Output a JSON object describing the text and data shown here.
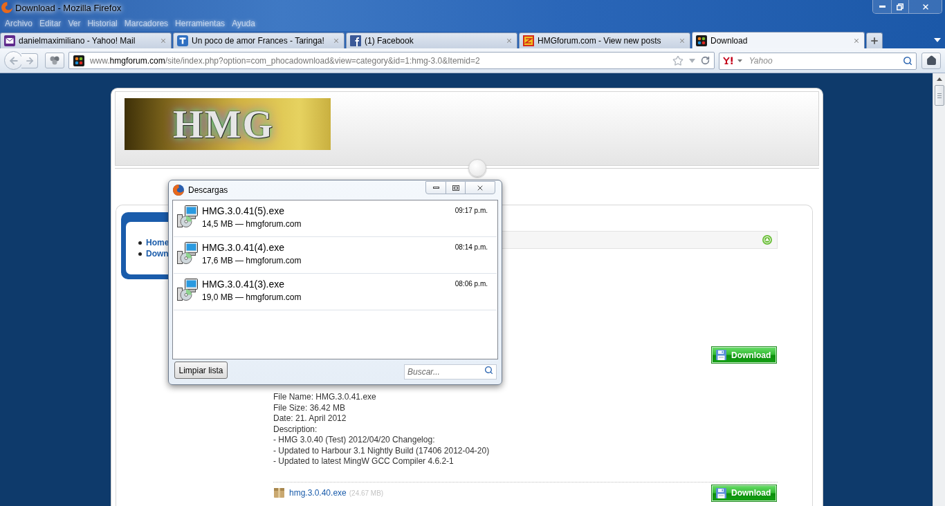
{
  "window": {
    "title": "Download - Mozilla Firefox"
  },
  "menu_bar": [
    {
      "label": "Archivo"
    },
    {
      "label": "Editar"
    },
    {
      "label": "Ver"
    },
    {
      "label": "Historial"
    },
    {
      "label": "Marcadores"
    },
    {
      "label": "Herramientas"
    },
    {
      "label": "Ayuda"
    }
  ],
  "tabs": [
    {
      "label": "danielmaximiliano - Yahoo! Mail",
      "kind": "envelope",
      "selected": false
    },
    {
      "label": "Un poco de amor Frances - Taringa!",
      "kind": "letter",
      "selected": false
    },
    {
      "label": "(1) Facebook",
      "kind": "f",
      "selected": false
    },
    {
      "label": "HMGforum.com - View new posts",
      "kind": "pattern",
      "selected": false
    },
    {
      "label": "Download",
      "kind": "dots",
      "selected": true
    }
  ],
  "address_bar": {
    "prefix": "www.",
    "domain": "hmgforum.com",
    "path": "/site/index.php?option=com_phocadownload&view=category&id=1:hmg-3.0&Itemid=2"
  },
  "search_bar": {
    "placeholder": "Yahoo"
  },
  "page": {
    "logo": {
      "text": "HMG"
    },
    "side_menu": [
      {
        "label": "Home"
      },
      {
        "label": "Down"
      }
    ],
    "download_button": "Download",
    "file_details": [
      "File Name: HMG.3.0.41.exe",
      "File Size: 36.42 MB",
      "Date: 21. April 2012",
      "Description:",
      "- HMG 3.0.40 (Test) 2012/04/20 Changelog:",
      "- Updated to Harbour 3.1 Nightly Build (17406 2012-04-20)",
      "- Updated to latest MingW GCC Compiler 4.6.2-1"
    ],
    "next_file": {
      "name": "hmg.3.0.40.exe",
      "size": "(24.67 MB)",
      "download_button": "Download"
    }
  },
  "downloads_dialog": {
    "title": "Descargas",
    "items": [
      {
        "name": "HMG.3.0.41(5).exe",
        "info": "14,5 MB — hmgforum.com",
        "time": "09:17 p.m."
      },
      {
        "name": "HMG.3.0.41(4).exe",
        "info": "17,6 MB — hmgforum.com",
        "time": "08:14 p.m."
      },
      {
        "name": "HMG.3.0.41(3).exe",
        "info": "19,0 MB — hmgforum.com",
        "time": "08:06 p.m."
      }
    ],
    "clear_button": "Limpiar lista",
    "search": {
      "placeholder": "Buscar..."
    }
  }
}
